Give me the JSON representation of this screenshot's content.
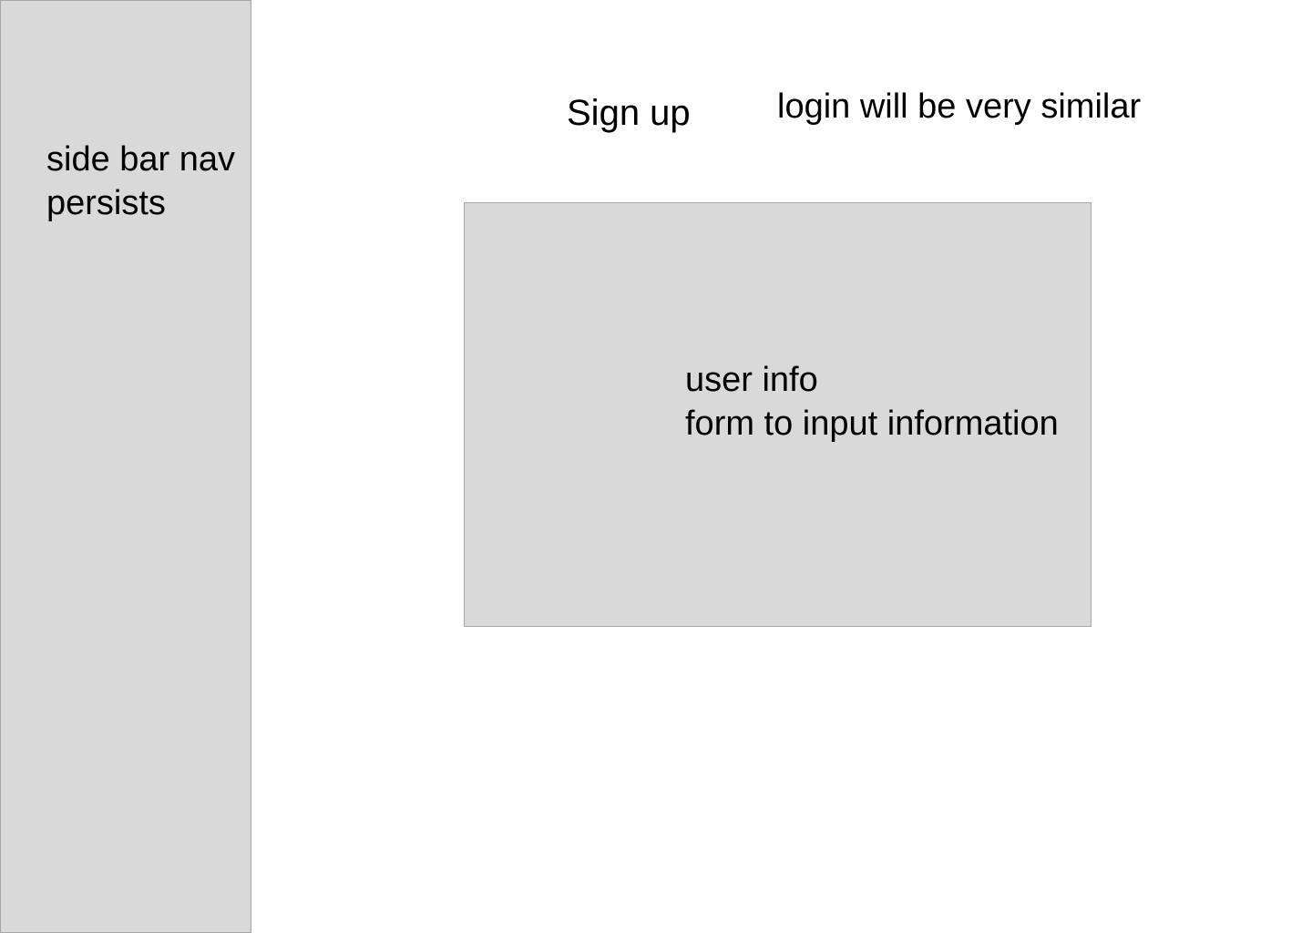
{
  "sidebar": {
    "note_line1": "side bar nav",
    "note_line2": "persists"
  },
  "header": {
    "title": "Sign up",
    "note": "login will be very similar"
  },
  "form": {
    "note_line1": "user info",
    "note_line2": "form to input information"
  },
  "colors": {
    "placeholder_fill": "#d9d9d9",
    "placeholder_border": "#a6a6a6",
    "background": "#ffffff",
    "text": "#000000"
  }
}
